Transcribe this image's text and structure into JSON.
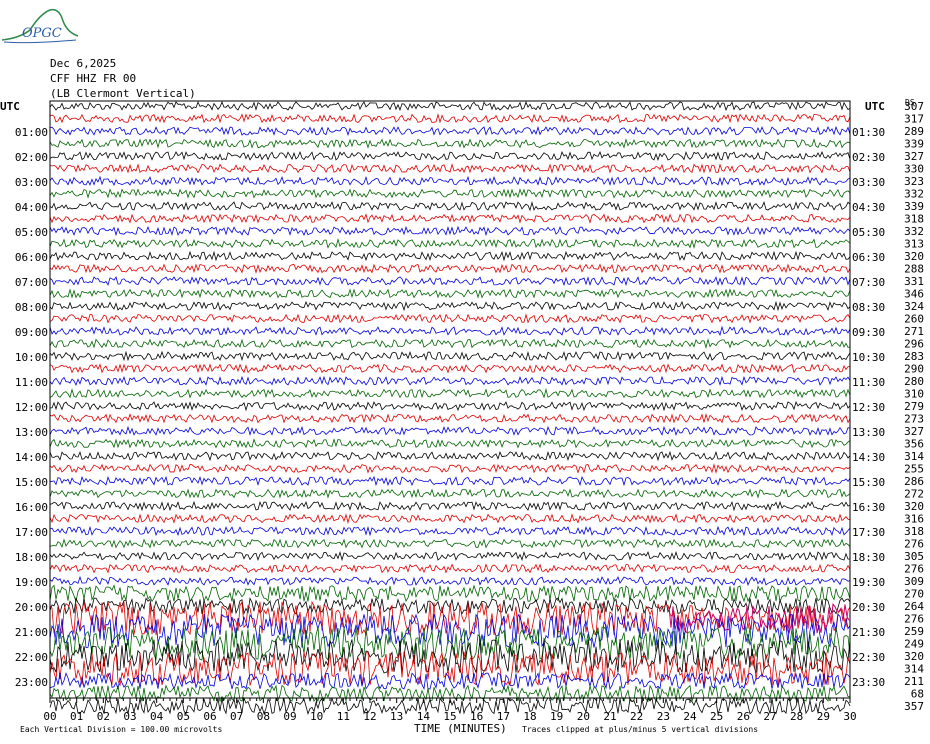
{
  "logo": {
    "text": "OPGC"
  },
  "header": {
    "date": "Dec 6,2025",
    "station": "CFF HHZ FR 00",
    "location": "(LB Clermont Vertical)"
  },
  "axes": {
    "left_title": "UTC",
    "right_title": "UTC",
    "ds_label": "DS",
    "x_title": "TIME (MINUTES)",
    "footer_left": "Each Vertical Division =  100.00 microvolts",
    "footer_right": "Traces clipped at plus/minus 5 vertical divisions"
  },
  "chart_data": {
    "type": "line",
    "subtype": "helicorder",
    "x_range": [
      0,
      30
    ],
    "x_ticks": [
      "00",
      "01",
      "02",
      "03",
      "04",
      "05",
      "06",
      "07",
      "08",
      "09",
      "10",
      "11",
      "12",
      "13",
      "14",
      "15",
      "16",
      "17",
      "18",
      "19",
      "20",
      "21",
      "22",
      "23",
      "24",
      "25",
      "26",
      "27",
      "28",
      "29",
      "30"
    ],
    "left_labels": [
      "01:00",
      "02:00",
      "03:00",
      "04:00",
      "05:00",
      "06:00",
      "07:00",
      "08:00",
      "09:00",
      "10:00",
      "11:00",
      "12:00",
      "13:00",
      "14:00",
      "15:00",
      "16:00",
      "17:00",
      "18:00",
      "19:00",
      "20:00",
      "21:00",
      "22:00",
      "23:00"
    ],
    "right_labels": [
      "01:30",
      "02:30",
      "03:30",
      "04:30",
      "05:30",
      "06:30",
      "07:30",
      "08:30",
      "09:30",
      "10:30",
      "11:30",
      "12:30",
      "13:30",
      "14:30",
      "15:30",
      "16:30",
      "17:30",
      "18:30",
      "19:30",
      "20:30",
      "21:30",
      "22:30",
      "23:30"
    ],
    "trace_colors": [
      "#000000",
      "#e00000",
      "#0000e0",
      "#006400"
    ],
    "ds_values": [
      "307",
      "317",
      "289",
      "339",
      "327",
      "330",
      "323",
      "332",
      "339",
      "318",
      "332",
      "313",
      "320",
      "288",
      "331",
      "346",
      "324",
      "260",
      "271",
      "296",
      "283",
      "290",
      "280",
      "310",
      "279",
      "273",
      "327",
      "356",
      "314",
      "255",
      "286",
      "272",
      "320",
      "316",
      "318",
      "276",
      "305",
      "276",
      "309",
      "270",
      "264",
      "276",
      "259",
      "249",
      "320",
      "314",
      "211",
      "68",
      "357"
    ],
    "trace_amplitude": [
      "low",
      "low",
      "low",
      "low",
      "low",
      "low",
      "low",
      "low",
      "low",
      "low",
      "low",
      "low",
      "low",
      "low",
      "low",
      "low",
      "low",
      "low",
      "low",
      "low",
      "low",
      "low",
      "low",
      "low",
      "low",
      "low",
      "low",
      "low",
      "low",
      "low",
      "low",
      "low",
      "low",
      "low",
      "low",
      "low",
      "low",
      "low",
      "low",
      "medium",
      "medium",
      "high",
      "high",
      "high",
      "high",
      "high",
      "medium",
      "medium",
      "medium"
    ],
    "event": {
      "trace_index": 41,
      "x_start": 23.2,
      "x_end": 30,
      "color": "#cc0066"
    }
  }
}
